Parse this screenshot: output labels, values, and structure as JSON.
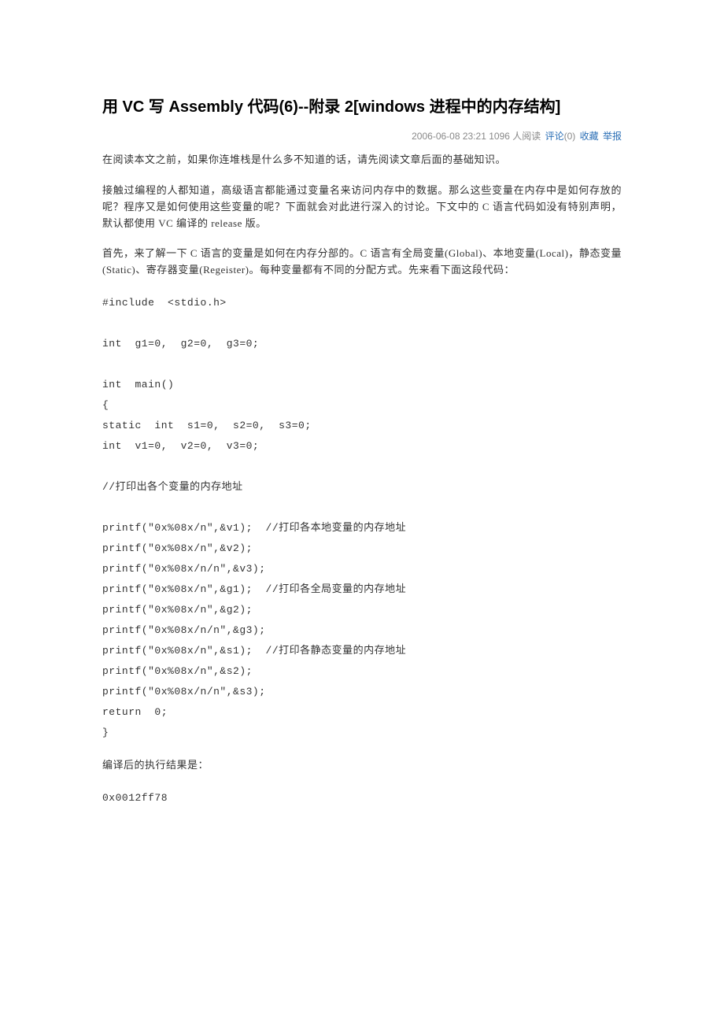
{
  "title": "用 VC 写 Assembly 代码(6)--附录 2[windows 进程中的内存结构]",
  "meta": {
    "datetime": "2006-06-08 23:21",
    "reads": "1096 人阅读",
    "comments_label": "评论",
    "comments_count": "(0)",
    "favorite": "收藏",
    "report": "举报"
  },
  "paragraphs": {
    "p1": "在阅读本文之前，如果你连堆栈是什么多不知道的话，请先阅读文章后面的基础知识。",
    "p2": "接触过编程的人都知道，高级语言都能通过变量名来访问内存中的数据。那么这些变量在内存中是如何存放的呢？程序又是如何使用这些变量的呢？下面就会对此进行深入的讨论。下文中的 C 语言代码如没有特别声明，默认都使用 VC 编译的 release 版。",
    "p3": "首先，来了解一下  C  语言的变量是如何在内存分部的。C  语言有全局变量(Global)、本地变量(Local)，静态变量(Static)、寄存器变量(Regeister)。每种变量都有不同的分配方式。先来看下面这段代码：",
    "p4": "编译后的执行结果是："
  },
  "code": {
    "block1": "#include  <stdio.h>\n\nint  g1=0,  g2=0,  g3=0;\n\nint  main()\n{\nstatic  int  s1=0,  s2=0,  s3=0;\nint  v1=0,  v2=0,  v3=0;\n\n//打印出各个变量的内存地址\n\nprintf(\"0x%08x/n\",&v1);  //打印各本地变量的内存地址\nprintf(\"0x%08x/n\",&v2);\nprintf(\"0x%08x/n/n\",&v3);\nprintf(\"0x%08x/n\",&g1);  //打印各全局变量的内存地址\nprintf(\"0x%08x/n\",&g2);\nprintf(\"0x%08x/n/n\",&g3);\nprintf(\"0x%08x/n\",&s1);  //打印各静态变量的内存地址\nprintf(\"0x%08x/n\",&s2);\nprintf(\"0x%08x/n/n\",&s3);\nreturn  0;\n}",
    "result1": "0x0012ff78"
  }
}
